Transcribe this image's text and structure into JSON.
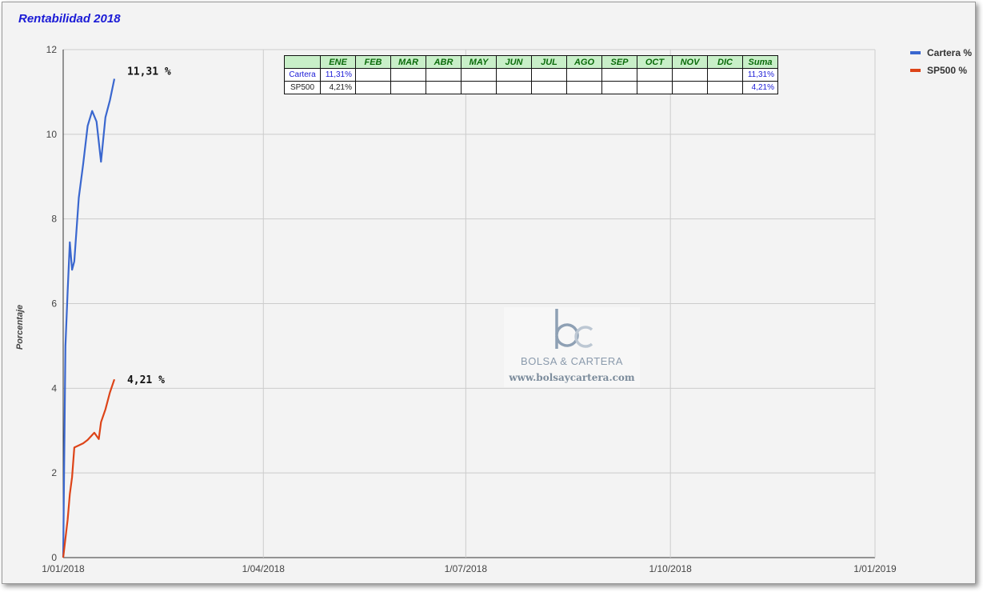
{
  "chart_data": {
    "type": "line",
    "title": "Rentabilidad 2018",
    "xlabel": "",
    "ylabel": "Porcentaje",
    "x_ticks": [
      "1/01/2018",
      "1/04/2018",
      "1/07/2018",
      "1/10/2018",
      "1/01/2019"
    ],
    "xlim": [
      "2018-01-01",
      "2019-01-01"
    ],
    "y_ticks": [
      0,
      2,
      4,
      6,
      8,
      10,
      12
    ],
    "ylim": [
      0,
      12
    ],
    "grid": true,
    "legend_position": "right",
    "series": [
      {
        "name": "Cartera %",
        "color": "#3a67cf",
        "end_label": "11,31 %",
        "x": [
          "2018-01-01",
          "2018-01-02",
          "2018-01-03",
          "2018-01-04",
          "2018-01-05",
          "2018-01-06",
          "2018-01-08",
          "2018-01-10",
          "2018-01-12",
          "2018-01-14",
          "2018-01-16",
          "2018-01-18",
          "2018-01-20",
          "2018-01-22",
          "2018-01-24"
        ],
        "y": [
          0.0,
          5.0,
          6.3,
          7.45,
          6.8,
          7.0,
          8.5,
          9.3,
          10.2,
          10.55,
          10.3,
          9.35,
          10.4,
          10.8,
          11.31
        ]
      },
      {
        "name": "SP500 %",
        "color": "#dd4418",
        "end_label": "4,21 %",
        "x": [
          "2018-01-01",
          "2018-01-03",
          "2018-01-04",
          "2018-01-05",
          "2018-01-06",
          "2018-01-08",
          "2018-01-10",
          "2018-01-12",
          "2018-01-15",
          "2018-01-17",
          "2018-01-18",
          "2018-01-20",
          "2018-01-22",
          "2018-01-24"
        ],
        "y": [
          0.0,
          0.9,
          1.5,
          1.9,
          2.6,
          2.65,
          2.7,
          2.78,
          2.95,
          2.8,
          3.2,
          3.5,
          3.9,
          4.21
        ]
      }
    ]
  },
  "monthly_table": {
    "headers": [
      "",
      "ENE",
      "FEB",
      "MAR",
      "ABR",
      "MAY",
      "JUN",
      "JUL",
      "AGO",
      "SEP",
      "OCT",
      "NOV",
      "DIC",
      "Suma"
    ],
    "rows": [
      {
        "label": "Cartera",
        "values": [
          "11,31%",
          "",
          "",
          "",
          "",
          "",
          "",
          "",
          "",
          "",
          "",
          "",
          "11,31%"
        ]
      },
      {
        "label": "SP500",
        "values": [
          "4,21%",
          "",
          "",
          "",
          "",
          "",
          "",
          "",
          "",
          "",
          "",
          "",
          "4,21%"
        ]
      }
    ]
  },
  "watermark": {
    "logo": "bc",
    "name": "BOLSA & CARTERA",
    "url": "www.bolsaycartera.com"
  },
  "colors": {
    "title": "#1b1bd6",
    "table_header_bg": "#c8efc8",
    "table_header_text": "#0a6a0a",
    "grid": "#cccccc",
    "plot_bg": "#f3f3f3"
  }
}
